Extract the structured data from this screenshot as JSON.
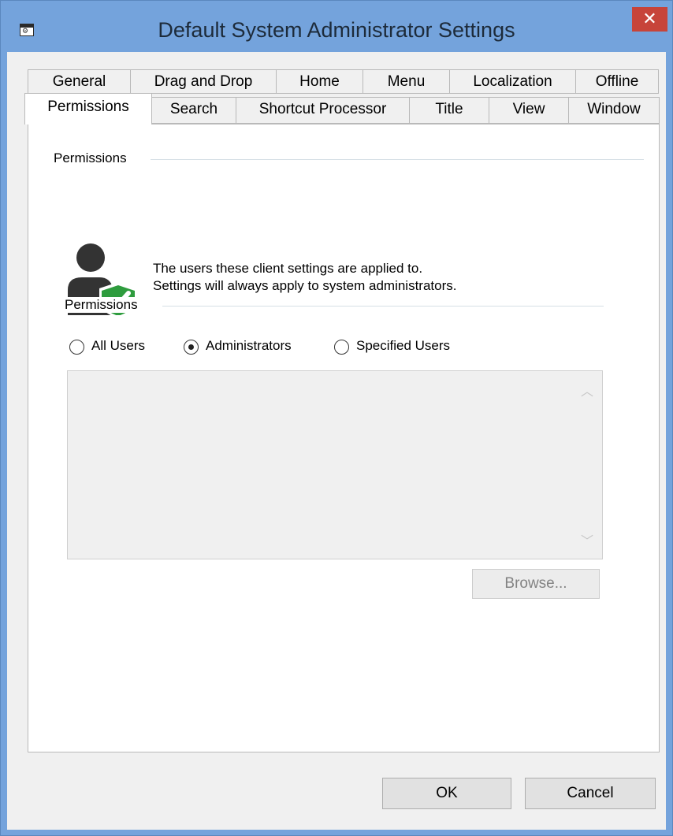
{
  "window": {
    "title": "Default System Administrator Settings",
    "close_glyph": "✕",
    "app_icon": "settings-window-icon",
    "app_icon_glyph": "⚙"
  },
  "tabs": {
    "row_back": [
      {
        "label": "General"
      },
      {
        "label": "Drag and Drop"
      },
      {
        "label": "Home"
      },
      {
        "label": "Menu"
      },
      {
        "label": "Localization"
      },
      {
        "label": "Offline"
      }
    ],
    "row_front": [
      {
        "label": "Permissions",
        "selected": true
      },
      {
        "label": "Search"
      },
      {
        "label": "Shortcut Processor"
      },
      {
        "label": "Title"
      },
      {
        "label": "View"
      },
      {
        "label": "Window"
      }
    ]
  },
  "permissions_group": {
    "label": "Permissions",
    "icon": "user-shield-check-icon",
    "description_line1": "The users these client settings are applied to.",
    "description_line2": "Settings will always apply to system administrators."
  },
  "scope_group": {
    "label": "Permissions",
    "options": [
      {
        "label": "All Users",
        "checked": false
      },
      {
        "label": "Administrators",
        "checked": true
      },
      {
        "label": "Specified Users",
        "checked": false
      }
    ]
  },
  "user_list": {
    "items": [],
    "scroll_up_glyph": "︿",
    "scroll_down_glyph": "﹀"
  },
  "browse_label": "Browse...",
  "footer": {
    "ok_label": "OK",
    "cancel_label": "Cancel"
  },
  "colors": {
    "frame": "#74a3dc",
    "close": "#c7443a",
    "shield": "#2e9c3e",
    "user": "#333333"
  }
}
